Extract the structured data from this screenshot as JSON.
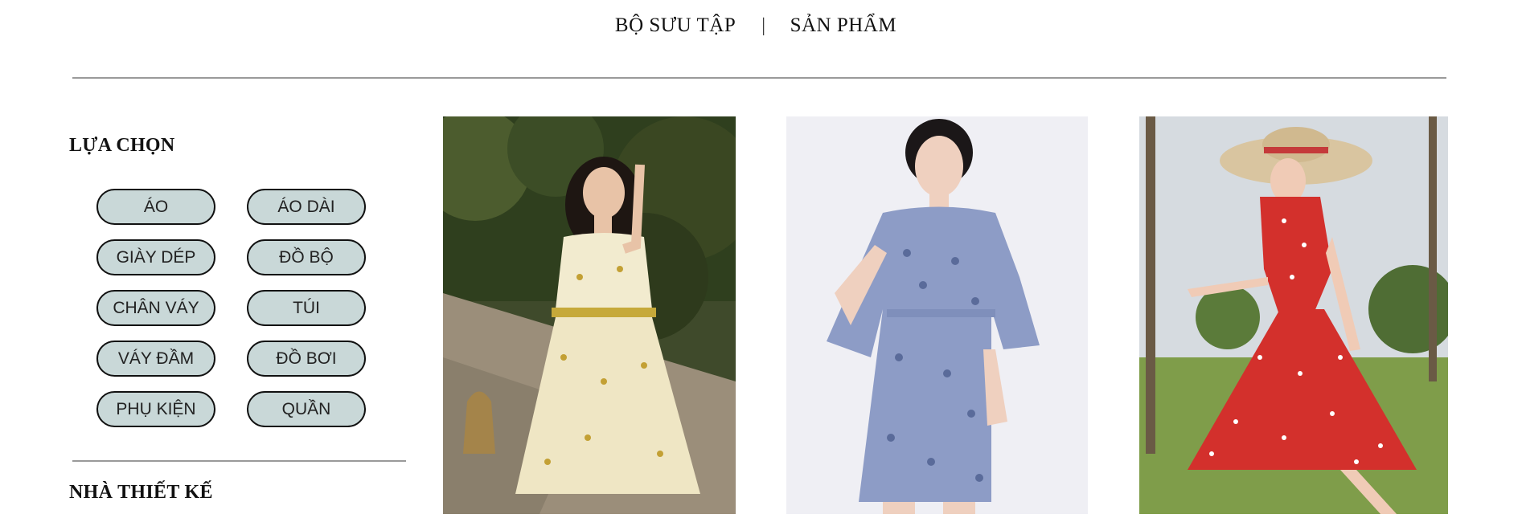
{
  "nav": {
    "collection_label": "BỘ SƯU TẬP",
    "separator": "|",
    "products_label": "SẢN PHẨM"
  },
  "sidebar": {
    "filter_title": "LỰA CHỌN",
    "categories": [
      "ÁO",
      "ÁO DÀI",
      "GIÀY DÉP",
      "ĐỒ BỘ",
      "CHÂN VÁY",
      "TÚI",
      "VÁY ĐẦM",
      "ĐỒ BƠI",
      "PHỤ KIỆN",
      "QUẦN"
    ],
    "designer_title": "NHÀ THIẾT KẾ"
  },
  "products": [
    {
      "image": "floral-cream-dress-photo"
    },
    {
      "image": "blue-floral-shirt-dress-photo"
    },
    {
      "image": "red-polka-dress-photo"
    }
  ],
  "colors": {
    "pill_bg": "#c9d8d8",
    "divider": "#9a9a9a"
  }
}
